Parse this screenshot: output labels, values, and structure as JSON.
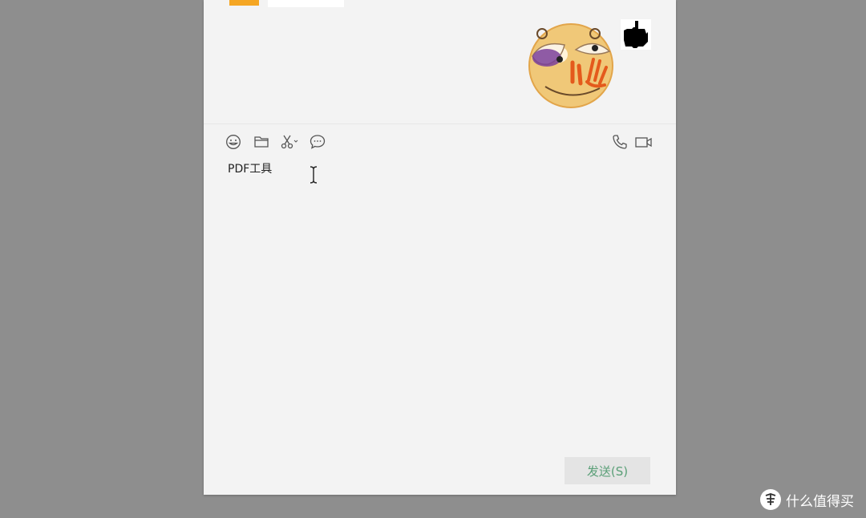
{
  "chat": {
    "message_area": {
      "sticker": "emoji-sticker",
      "self_avatar": "hand-avatar"
    },
    "toolbar": {
      "left_icons": [
        "emoji-icon",
        "folder-icon",
        "scissors-icon",
        "chat-history-icon"
      ],
      "right_icons": [
        "phone-icon",
        "video-call-icon"
      ]
    },
    "input": {
      "value": "PDF工具"
    },
    "send_button": {
      "label": "发送(S)"
    }
  },
  "watermark": {
    "text": "什么值得买"
  },
  "colors": {
    "backdrop": "#8e8e8e",
    "window_bg": "#f3f3f3",
    "send_text": "#5a9f77",
    "send_bg": "#e4e4e4",
    "accent_orange": "#f5a623"
  }
}
